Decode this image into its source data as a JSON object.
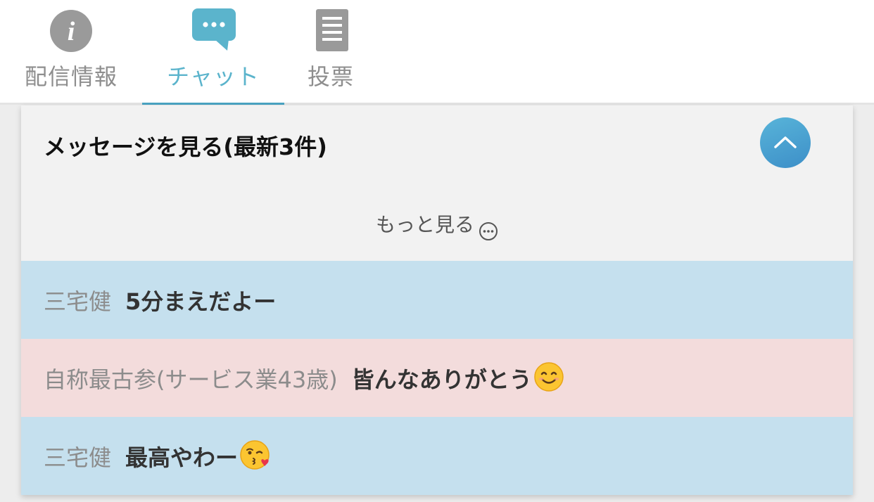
{
  "tabs": [
    {
      "label": "配信情報",
      "icon": "info-icon",
      "active": false
    },
    {
      "label": "チャット",
      "icon": "chat-bubble-icon",
      "active": true
    },
    {
      "label": "投票",
      "icon": "document-list-icon",
      "active": false
    }
  ],
  "colors": {
    "accent": "#4aa4c3",
    "active_tab_text": "#5bb4cc",
    "message_blue": "#c5e0ee",
    "message_pink": "#f3dcdc"
  },
  "panel": {
    "title": "メッセージを見る(最新3件)",
    "collapse_icon": "chevron-up-icon",
    "more_label": "もっと見る",
    "more_icon": "ellipsis-circle-icon"
  },
  "messages": [
    {
      "author": "三宅健",
      "text": "5分まえだよー",
      "emoji": ""
    },
    {
      "author": "自称最古参(サービス業43歳)",
      "text": "皆んなありがとう",
      "emoji": "smiling-face-icon"
    },
    {
      "author": "三宅健",
      "text": "最高やわー",
      "emoji": "kissing-face-heart-icon"
    }
  ]
}
